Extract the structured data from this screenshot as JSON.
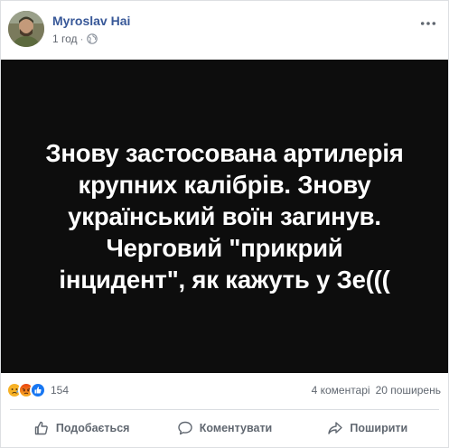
{
  "post": {
    "author": "Myroslav Hai",
    "time": "1 год",
    "separator": "·"
  },
  "image": {
    "text": "Знову застосована артилерія\nкрупних калібрів. Знову\nукраїнський воїн загинув.\nЧерговий \"прикрий\nінцидент\", як кажуть у Зе((("
  },
  "reactions": {
    "icons": [
      "sad-reaction-icon",
      "angry-reaction-icon",
      "like-reaction-icon"
    ],
    "count": "154",
    "comments": "4 коментарі",
    "shares": "20 поширень"
  },
  "actions": {
    "like": "Подобається",
    "comment": "Коментувати",
    "share": "Поширити"
  },
  "colors": {
    "author_link": "#385898",
    "image_bg": "#0d0d0d",
    "muted": "#606770",
    "like_blue": "#1877f2",
    "angry": "#e9710f",
    "sad": "#f7b125"
  }
}
